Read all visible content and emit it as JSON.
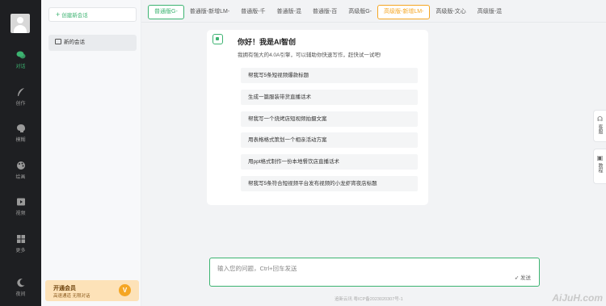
{
  "rail": {
    "items": [
      {
        "label": "对话",
        "icon": "chat-bubbles-icon"
      },
      {
        "label": "创作",
        "icon": "feather-icon"
      },
      {
        "label": "模糊",
        "icon": "brain-icon"
      },
      {
        "label": "绘画",
        "icon": "palette-icon"
      },
      {
        "label": "视频",
        "icon": "video-icon"
      },
      {
        "label": "更多",
        "icon": "grid-icon"
      },
      {
        "label": "夜间",
        "icon": "moon-icon"
      }
    ]
  },
  "sidebar": {
    "new_chat_label": "创建新会话",
    "conversation_label": "新的会话",
    "vip_title": "开通会员",
    "vip_subtitle": "高速通道 无限对话",
    "vip_badge": "V"
  },
  "tabs": [
    "普通版G-",
    "普通版-新增LM-",
    "普通版-千",
    "普通版-混",
    "普通版-百",
    "高级版G-",
    "高级版-新增LM-",
    "高级版-文心",
    "高级版-混"
  ],
  "card": {
    "greeting": "你好！我是AI智创",
    "subtitle": "我拥有强大的4.0A引擎，可以辅助你快速写作，赶快试一试吧!",
    "suggestions": [
      "帮我写5条短视频爆款标题",
      "生成一篇服装带货直播话术",
      "帮我写一个烧烤店短视频拍摄文案",
      "用表格格式策划一个相亲活动方案",
      "用ppt格式制作一份本地餐饮店直播话术",
      "帮我写5条符合短视频平台发布视频的小龙虾宵夜店标题"
    ]
  },
  "float": {
    "service": "客服",
    "tutorial": "教程"
  },
  "input": {
    "placeholder": "输入您的问题，Ctrl+回车发送",
    "send_label": "发送"
  },
  "footer": "追新云讯    粤ICP备2023020307号-1",
  "watermark": "AiJuH.com",
  "colors": {
    "accent": "#3cb371",
    "vip": "#f5a623",
    "rail_bg": "#1e1f22"
  }
}
